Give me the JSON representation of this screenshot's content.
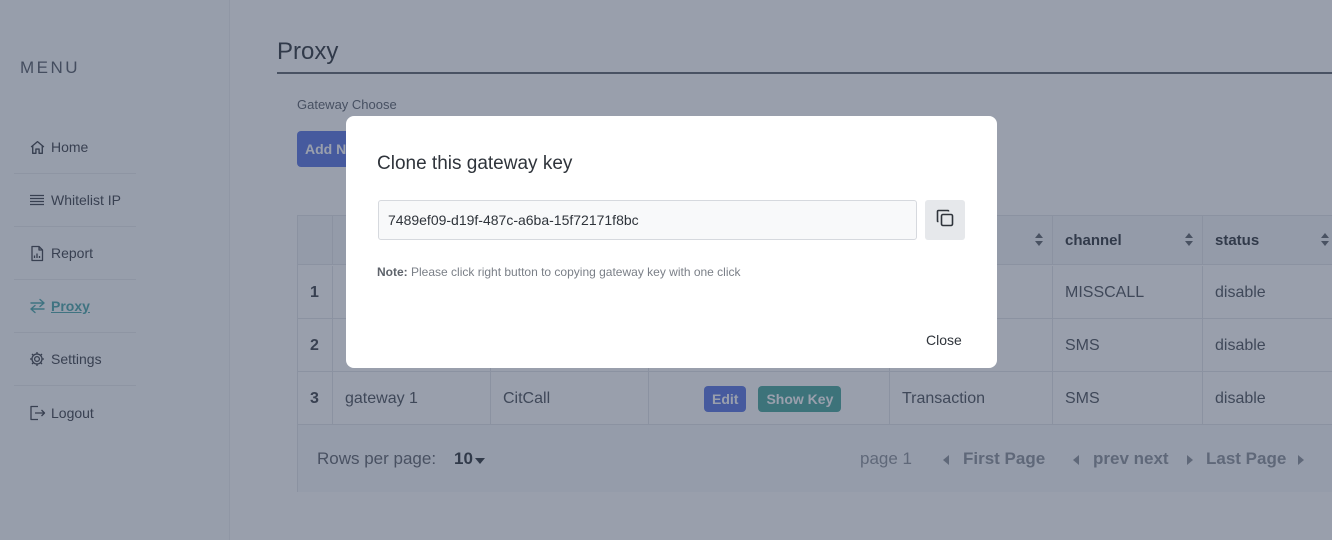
{
  "sidebar": {
    "menu_title": "MENU",
    "items": [
      {
        "label": "Home",
        "icon": "home-icon"
      },
      {
        "label": "Whitelist IP",
        "icon": "list-icon"
      },
      {
        "label": "Report",
        "icon": "report-icon"
      },
      {
        "label": "Proxy",
        "icon": "swap-arrows-icon",
        "active": true
      },
      {
        "label": "Settings",
        "icon": "gear-icon"
      },
      {
        "label": "Logout",
        "icon": "logout-icon"
      }
    ]
  },
  "page": {
    "title": "Proxy",
    "gateway_label": "Gateway Choose",
    "add_button": "Add New"
  },
  "table": {
    "headers": [
      "",
      "",
      "",
      "",
      "",
      "channel",
      "status"
    ],
    "rows": [
      {
        "num": "1",
        "name": "",
        "provider": "",
        "type": "",
        "channel": "MISSCALL",
        "status": "disable"
      },
      {
        "num": "2",
        "name": "",
        "provider": "",
        "type": "",
        "channel": "SMS",
        "status": "disable"
      },
      {
        "num": "3",
        "name": "gateway 1",
        "provider": "CitCall",
        "type": "Transaction",
        "channel": "SMS",
        "status": "disable"
      }
    ],
    "edit_label": "Edit",
    "show_key_label": "Show Key",
    "footer": {
      "rows_per_page_label": "Rows per page:",
      "rows_per_page_value": "10",
      "page_text": "page 1",
      "first_page": "First Page",
      "prev_next": "prev next",
      "last_page": "Last Page"
    }
  },
  "modal": {
    "title": "Clone this gateway key",
    "key_value": "7489ef09-d19f-487c-a6ba-15f72171f8bc",
    "note_label": "Note:",
    "note_text": "Please click right button to copying gateway key with one click",
    "close_label": "Close",
    "copy_icon": "copy-icon"
  },
  "colors": {
    "accent_blue": "#5975e3",
    "accent_teal": "#46a79a",
    "active_link": "#4aa7a9"
  }
}
